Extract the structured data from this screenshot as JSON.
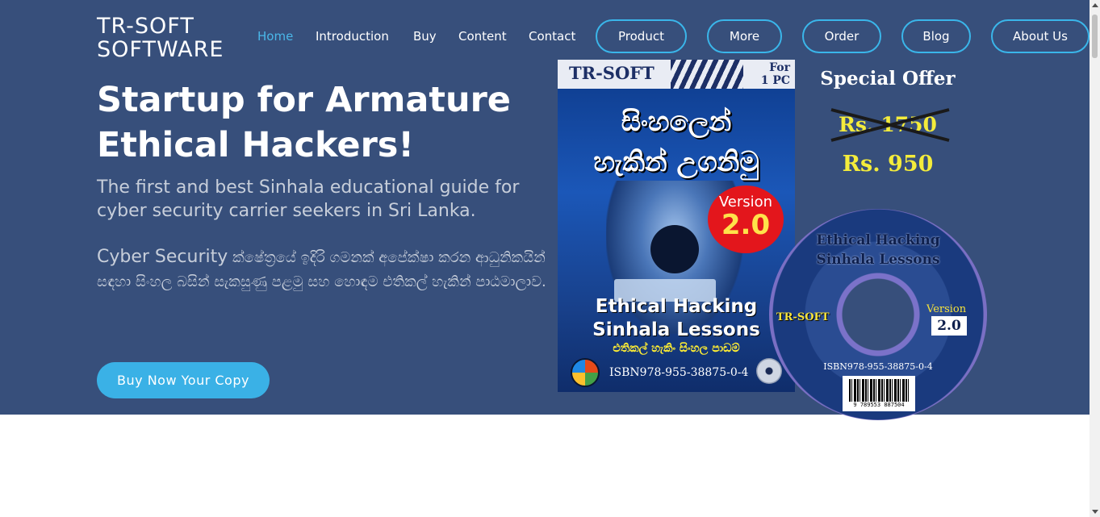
{
  "brand": {
    "line1": "TR-SOFT",
    "line2": "SOFTWARE"
  },
  "nav": {
    "links": [
      "Home",
      "Introduction",
      "Buy",
      "Content",
      "Contact"
    ],
    "pills": [
      "Product",
      "More",
      "Order",
      "Blog",
      "About Us"
    ],
    "active": "Home"
  },
  "hero": {
    "headline_line1": "Startup for Armature",
    "headline_line2": "Ethical Hackers!",
    "subline": "The first and best Sinhala educational guide for cyber security carrier seekers in Sri Lanka.",
    "para_lead": "Cyber Security",
    "para_text": " ක්ෂේත්‍රයේ ඉදිරි ගමනක් අපේක්ෂා කරන ආධුනිකයින් සඳහා සිංහල බසින් සැකසුණු පළමු සහ හොඳම එතිකල් හැකින් පාඨමාලාව.",
    "cta": "Buy Now Your Copy"
  },
  "product_box": {
    "brand": "TR-SOFT",
    "for_line1": "For",
    "for_line2": "1 PC",
    "sinhala_line1": "සිංහලෙන්",
    "sinhala_line2": "හැකින් උගනිමු",
    "version_label": "Version",
    "version_number": "2.0",
    "title_line1": "Ethical Hacking",
    "title_line2": "Sinhala Lessons",
    "sub_sinhala": "එතිකල් හැකිං සිංහල පාඩම්",
    "isbn": "ISBN978-955-38875-0-4"
  },
  "offer": {
    "title": "Special Offer",
    "old_price": "Rs. 1750",
    "new_price": "Rs. 950"
  },
  "disc": {
    "title_line1": "Ethical Hacking",
    "title_line2": "Sinhala Lessons",
    "brand": "TR-SOFT",
    "version_label": "Version",
    "version_number": "2.0",
    "isbn": "ISBN978-955-38875-0-4",
    "barcode_number": "9 789553 887504"
  },
  "colors": {
    "hero_bg": "#374f7b",
    "accent": "#3ab6ea",
    "offer_yellow": "#f4ec3b"
  }
}
